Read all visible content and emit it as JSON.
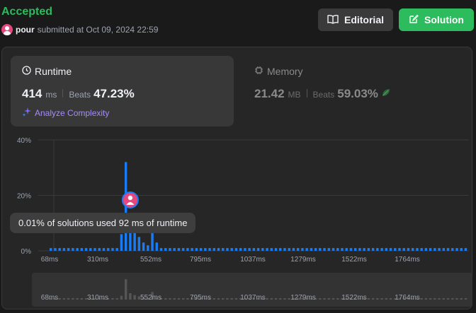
{
  "header": {
    "status": "Accepted",
    "user": "pour",
    "submitted_text": "submitted at Oct 09, 2024 22:59",
    "editorial_label": "Editorial",
    "solution_label": "Solution",
    "accent_green": "#2cbb5d"
  },
  "runtime": {
    "title": "Runtime",
    "value": "414",
    "unit": "ms",
    "beats_label": "Beats",
    "beats_value": "47.23%",
    "analyze_label": "Analyze Complexity"
  },
  "memory": {
    "title": "Memory",
    "value": "21.42",
    "unit": "MB",
    "beats_label": "Beats",
    "beats_value": "59.03%"
  },
  "tooltip": "0.01% of solutions used 92 ms of runtime",
  "chart_data": {
    "type": "bar",
    "title": "",
    "xlabel": "",
    "ylabel": "",
    "ylim": [
      0,
      40
    ],
    "yticks": [
      "40%",
      "20%",
      "0%"
    ],
    "xticks": [
      "68ms",
      "310ms",
      "552ms",
      "795ms",
      "1037ms",
      "1279ms",
      "1522ms",
      "1764ms"
    ],
    "bar_color": "#1a7cf5",
    "values": [
      1,
      1,
      1,
      1,
      1,
      1,
      1,
      1,
      1,
      1,
      1,
      1,
      1,
      1,
      1,
      1,
      6,
      32,
      10,
      7,
      5,
      3,
      2,
      12,
      3,
      1,
      1,
      1,
      1,
      1,
      1,
      1,
      1,
      1,
      1,
      1,
      1,
      1,
      1,
      1,
      1,
      1,
      1,
      1,
      1,
      1,
      1,
      1,
      1,
      1,
      1,
      1,
      1,
      1,
      1,
      1,
      1,
      1,
      1,
      1,
      1,
      1,
      1,
      1,
      1,
      1,
      1,
      1,
      1,
      1,
      1,
      1,
      1,
      1,
      1,
      1,
      1,
      1,
      1,
      1,
      1,
      1,
      1,
      1,
      1,
      1,
      1,
      1,
      1,
      1,
      1,
      1,
      1,
      1,
      1
    ],
    "highlight_index": 18
  }
}
